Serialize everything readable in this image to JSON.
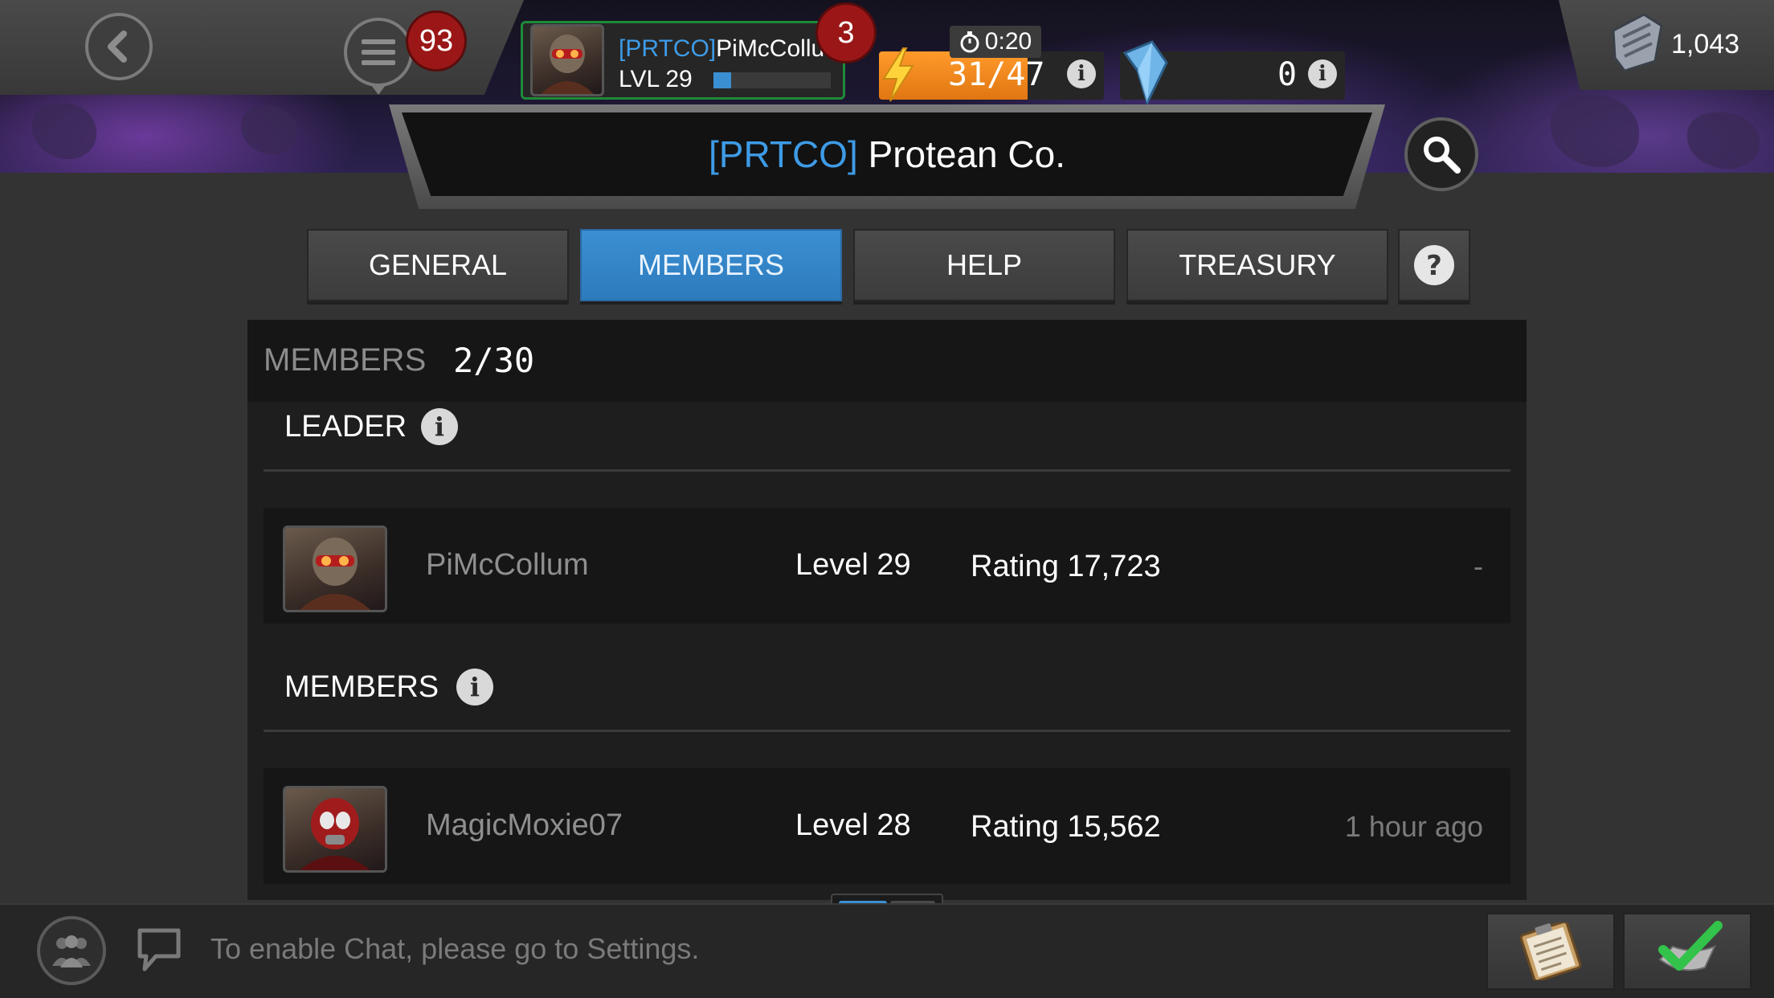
{
  "header": {
    "notifications_count": "93",
    "player": {
      "alliance_tag": "[PRTCO]",
      "name": "PiMcCollum",
      "level_label": "LVL 29",
      "xp_progress": 0.15,
      "badge_count": "3"
    },
    "energy": {
      "timer": "0:20",
      "value": "31/47",
      "fill_fraction": 0.66
    },
    "crystals": {
      "value": "0"
    },
    "units": {
      "value": "1,043"
    }
  },
  "banner": {
    "tag": "[PRTCO]",
    "name": "Protean Co."
  },
  "tabs": [
    {
      "label": "GENERAL",
      "active": false
    },
    {
      "label": "MEMBERS",
      "active": true
    },
    {
      "label": "HELP",
      "active": false
    },
    {
      "label": "TREASURY",
      "active": false
    }
  ],
  "members_panel": {
    "title": "MEMBERS",
    "count": "2/30",
    "leader_section": {
      "title": "LEADER",
      "rows": [
        {
          "name": "PiMcCollum",
          "level": "Level 29",
          "rating": "Rating 17,723",
          "status": "-"
        }
      ]
    },
    "members_section": {
      "title": "MEMBERS",
      "rows": [
        {
          "name": "MagicMoxie07",
          "level": "Level 28",
          "rating": "Rating 15,562",
          "status": "1 hour ago"
        }
      ]
    },
    "scroll_position": 0.6
  },
  "footer": {
    "chat_placeholder": "To enable Chat, please go to Settings."
  },
  "colors": {
    "accent_blue": "#3a8fd2",
    "badge_red": "#9b1717",
    "energy_orange": "#ff9a2b",
    "online_green": "#1f8a3a"
  },
  "icons": [
    "back-arrow-icon",
    "menu-icon",
    "lightning-icon",
    "timer-icon",
    "crystal-shard-icon",
    "info-icon",
    "units-icon",
    "search-icon",
    "help-icon",
    "alliance-group-icon",
    "chat-bubble-icon",
    "clipboard-icon",
    "checkmark-icon"
  ]
}
